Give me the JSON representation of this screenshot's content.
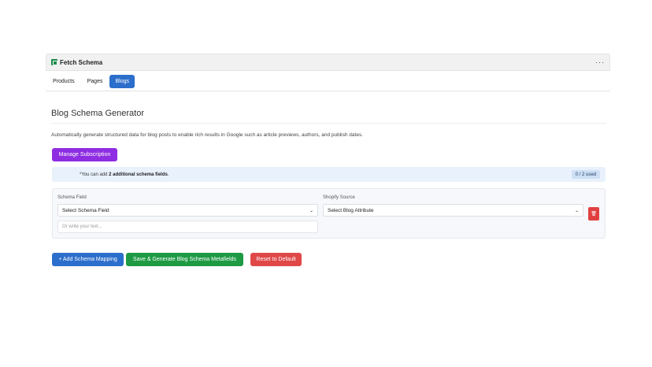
{
  "app_bar": {
    "logo_icon": "app-logo-icon",
    "title": "Fetch Schema",
    "more_label": "···"
  },
  "tabs": [
    {
      "label": "Products",
      "active": false
    },
    {
      "label": "Pages",
      "active": false
    },
    {
      "label": "Blogs",
      "active": true
    }
  ],
  "main": {
    "title": "Blog Schema Generator",
    "description": "Automatically generate structured data for blog posts to enable rich results in Google such as article previews, authors, and publish dates.",
    "manage_subscription_label": "Manage Subscription"
  },
  "info": {
    "prefix": "*You can add ",
    "highlight": "2 additional schema fields",
    "suffix": ".",
    "usage_badge": "0 / 2 used"
  },
  "mapping": {
    "schema_field_label": "Schema Field",
    "schema_field_value": "Select Schema Field",
    "custom_text_placeholder": "Or write your text...",
    "shopify_source_label": "Shopify Source",
    "shopify_source_value": "Select Blog Attribute",
    "delete_label": "🗑"
  },
  "actions": {
    "add_mapping_label": "+ Add Schema Mapping",
    "save_generate_label": "Save & Generate Blog Schema Metafields",
    "reset_label": "Reset to Default"
  },
  "colors": {
    "primary": "#2c6ecb",
    "purple": "#8e2de2",
    "success": "#1e9a44",
    "danger": "#e04848",
    "info_bg": "#e9f2fc"
  }
}
